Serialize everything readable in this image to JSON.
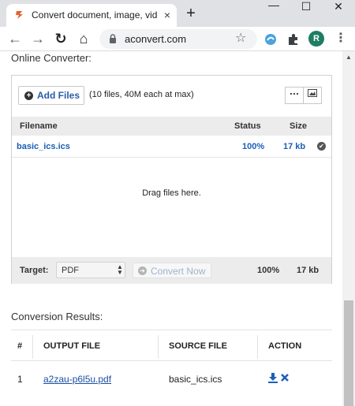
{
  "browser": {
    "tab_title": "Convert document, image, video",
    "tab_close": "×",
    "new_tab": "+",
    "minimize": "—",
    "maximize": "☐",
    "close": "✕",
    "back": "←",
    "forward": "→",
    "reload": "↻",
    "home": "⌂",
    "url": "aconvert.com",
    "star": "☆",
    "avatar_initial": "R",
    "kebab": "⋮",
    "colors": {
      "favicon": "#e8602c",
      "avatar": "#1e7d63",
      "ext_blue": "#4aa3df"
    }
  },
  "page": {
    "online_converter_title": "Online Converter:",
    "add_files_label": "Add Files",
    "add_files_icon": "+",
    "limit_text": "(10 files, 40M each at max)",
    "view_list_icon": "list-view-icon",
    "view_thumb_icon": "thumbnail-view-icon",
    "file_table": {
      "headers": {
        "filename": "Filename",
        "status": "Status",
        "size": "Size"
      },
      "rows": [
        {
          "filename": "basic_ics.ics",
          "status": "100%",
          "size": "17 kb"
        }
      ]
    },
    "drop_text": "Drag files here.",
    "target_label": "Target:",
    "target_value": "PDF",
    "convert_label": "Convert Now",
    "footer_status": "100%",
    "footer_size": "17 kb",
    "results_title": "Conversion Results:",
    "results_table": {
      "headers": {
        "num": "#",
        "output": "OUTPUT FILE",
        "source": "SOURCE FILE",
        "action": "ACTION"
      },
      "rows": [
        {
          "num": "1",
          "output": "a2zau-p6l5u.pdf",
          "source": "basic_ics.ics"
        }
      ]
    }
  }
}
